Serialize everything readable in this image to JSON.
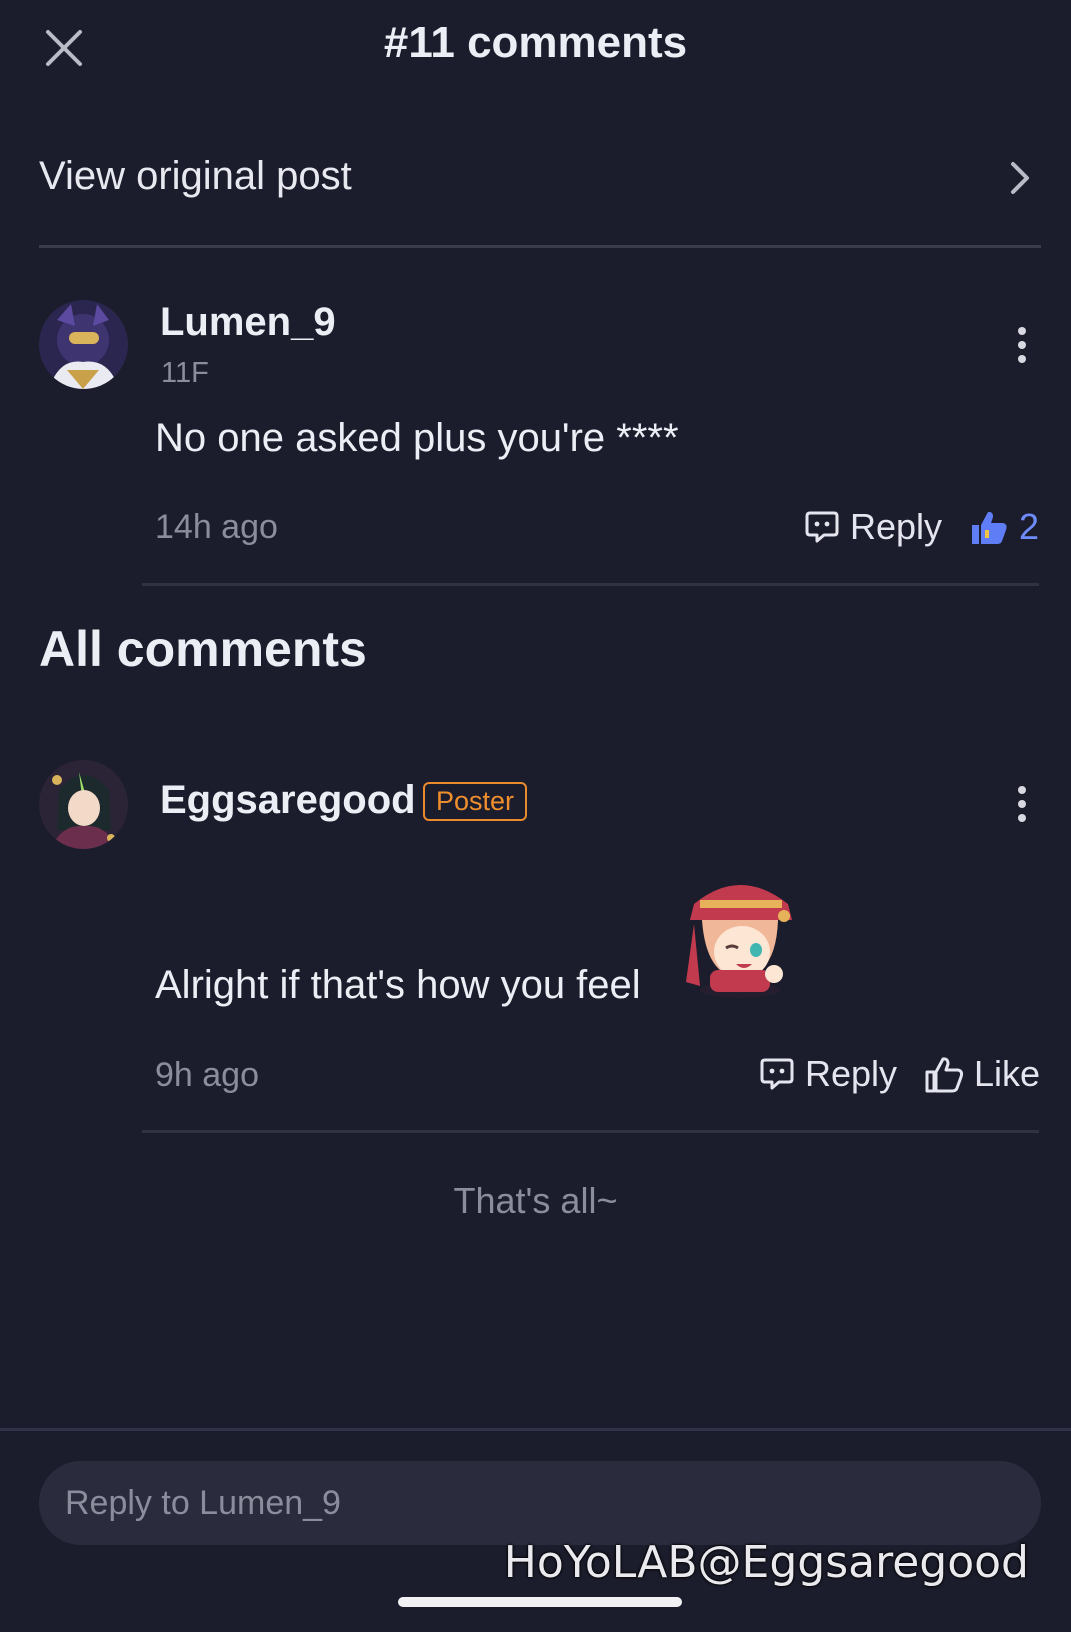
{
  "header": {
    "title": "#11 comments",
    "close_icon": "close-icon"
  },
  "view_post": {
    "label": "View original post",
    "chevron_icon": "chevron-right-icon"
  },
  "focused_comment": {
    "username": "Lumen_9",
    "floor": "11F",
    "text": "No one asked plus you're ****",
    "time": "14h ago",
    "reply_label": "Reply",
    "like_count": "2",
    "liked": true
  },
  "all_comments": {
    "title": "All comments",
    "items": [
      {
        "username": "Eggsaregood",
        "badge": "Poster",
        "text": "Alright if that's how you feel",
        "has_sticker": true,
        "time": "9h ago",
        "reply_label": "Reply",
        "like_label": "Like"
      }
    ]
  },
  "end_label": "That's all~",
  "reply_bar": {
    "placeholder": "Reply to Lumen_9"
  },
  "watermark": "HoYoLAB@Eggsaregood",
  "colors": {
    "background": "#1c1d2c",
    "accent_like": "#6f8cff",
    "poster_badge": "#ef8e2e",
    "muted_text": "#8b8d9c"
  }
}
